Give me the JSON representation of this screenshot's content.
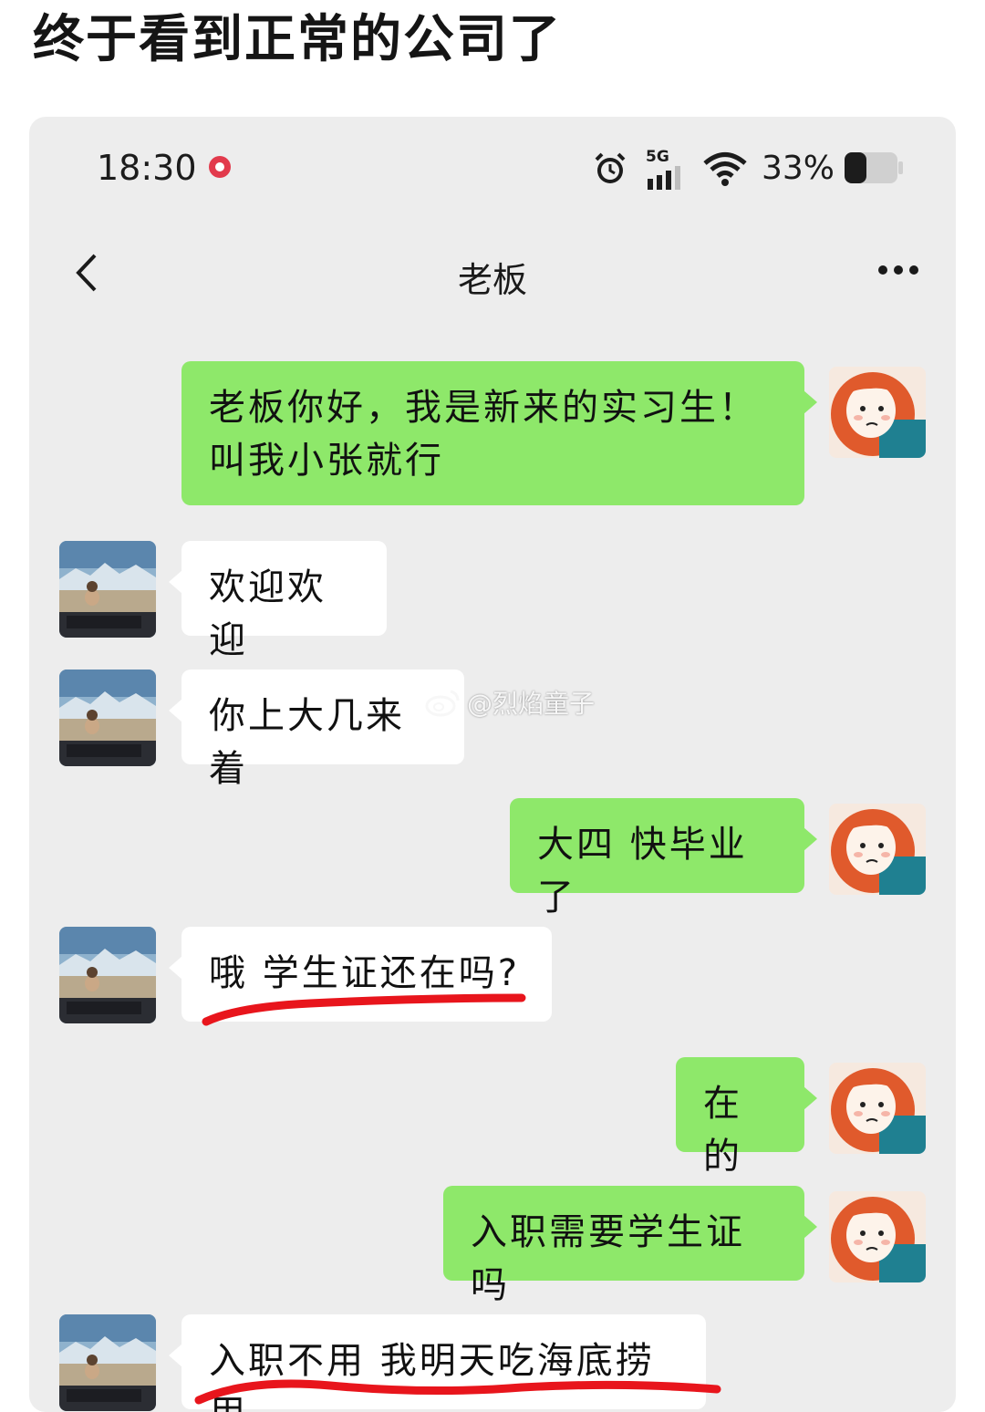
{
  "headline": "终于看到正常的公司了",
  "status_bar": {
    "time": "18:30",
    "network": "5G",
    "battery": "33%"
  },
  "nav": {
    "title": "老板"
  },
  "messages": [
    {
      "from": "me",
      "text": "老板你好，我是新来的实习生！\n叫我小张就行"
    },
    {
      "from": "other",
      "text": "欢迎欢迎"
    },
    {
      "from": "other",
      "text": "你上大几来着"
    },
    {
      "from": "me",
      "text": "大四 快毕业了"
    },
    {
      "from": "other",
      "text": "哦 学生证还在吗?"
    },
    {
      "from": "me",
      "text": "在的"
    },
    {
      "from": "me",
      "text": "入职需要学生证吗"
    },
    {
      "from": "other",
      "text": "入职不用 我明天吃海底捞用"
    }
  ],
  "watermark": "@烈焰童子",
  "colors": {
    "my_bubble": "#8ee86a",
    "other_bubble": "#ffffff",
    "chat_background": "#ededed",
    "underline": "#e8151c"
  }
}
